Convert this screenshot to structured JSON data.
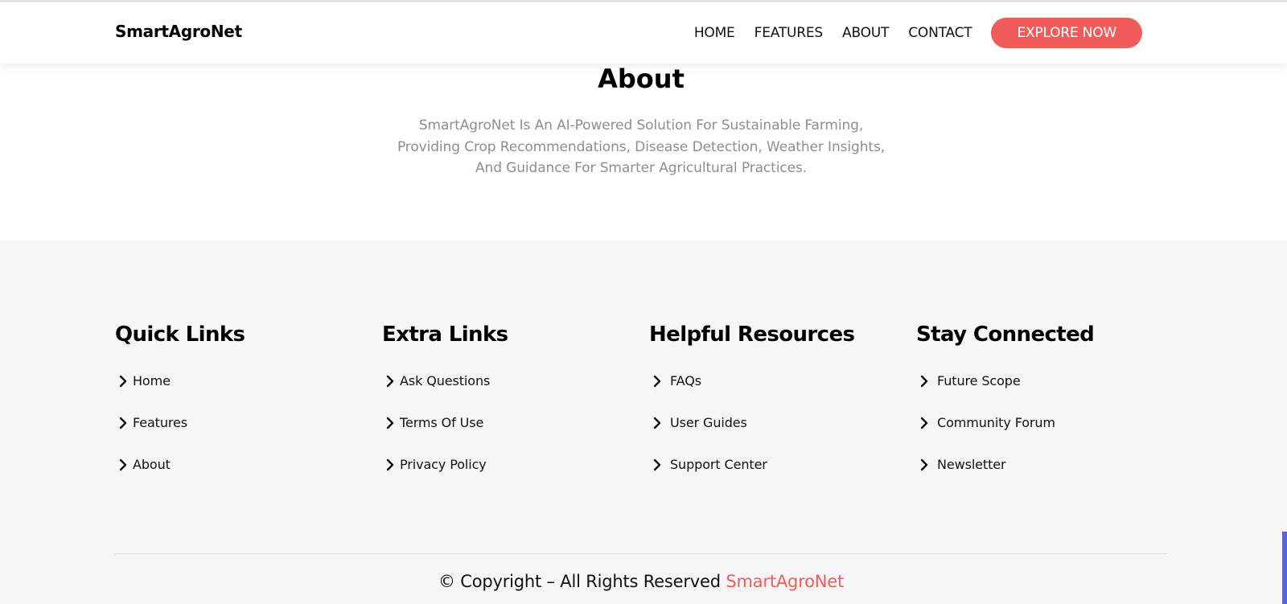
{
  "navbar": {
    "brand": "SmartAgroNet",
    "links": [
      {
        "label": "HOME"
      },
      {
        "label": "FEATURES"
      },
      {
        "label": "ABOUT"
      },
      {
        "label": "CONTACT"
      }
    ],
    "cta_label": "EXPLORE NOW"
  },
  "about": {
    "title": "About",
    "text": "SmartAgroNet Is An AI-Powered Solution For Sustainable Farming, Providing Crop Recommendations, Disease Detection, Weather Insights, And Guidance For Smarter Agricultural Practices."
  },
  "footer": {
    "columns": [
      {
        "title": "Quick Links",
        "items": [
          {
            "label": "Home"
          },
          {
            "label": "Features"
          },
          {
            "label": "About"
          }
        ]
      },
      {
        "title": "Extra Links",
        "items": [
          {
            "label": "Ask Questions"
          },
          {
            "label": "Terms Of Use"
          },
          {
            "label": "Privacy Policy"
          }
        ]
      },
      {
        "title": "Helpful Resources",
        "items": [
          {
            "label": "FAQs"
          },
          {
            "label": "User Guides"
          },
          {
            "label": "Support Center"
          }
        ]
      },
      {
        "title": "Stay Connected",
        "items": [
          {
            "label": "Future Scope"
          },
          {
            "label": "Community Forum"
          },
          {
            "label": "Newsletter"
          }
        ]
      }
    ],
    "copyright_text": "© Copyright – All Rights Reserved",
    "copyright_brand": "SmartAgroNet"
  },
  "icons": {
    "link_bullet": "chevron-right-icon"
  },
  "colors": {
    "accent": "#f25b5b",
    "footer_bg": "#f6f6f6",
    "muted_text": "#8e8e8e",
    "scrollbar": "#5b63d8"
  }
}
